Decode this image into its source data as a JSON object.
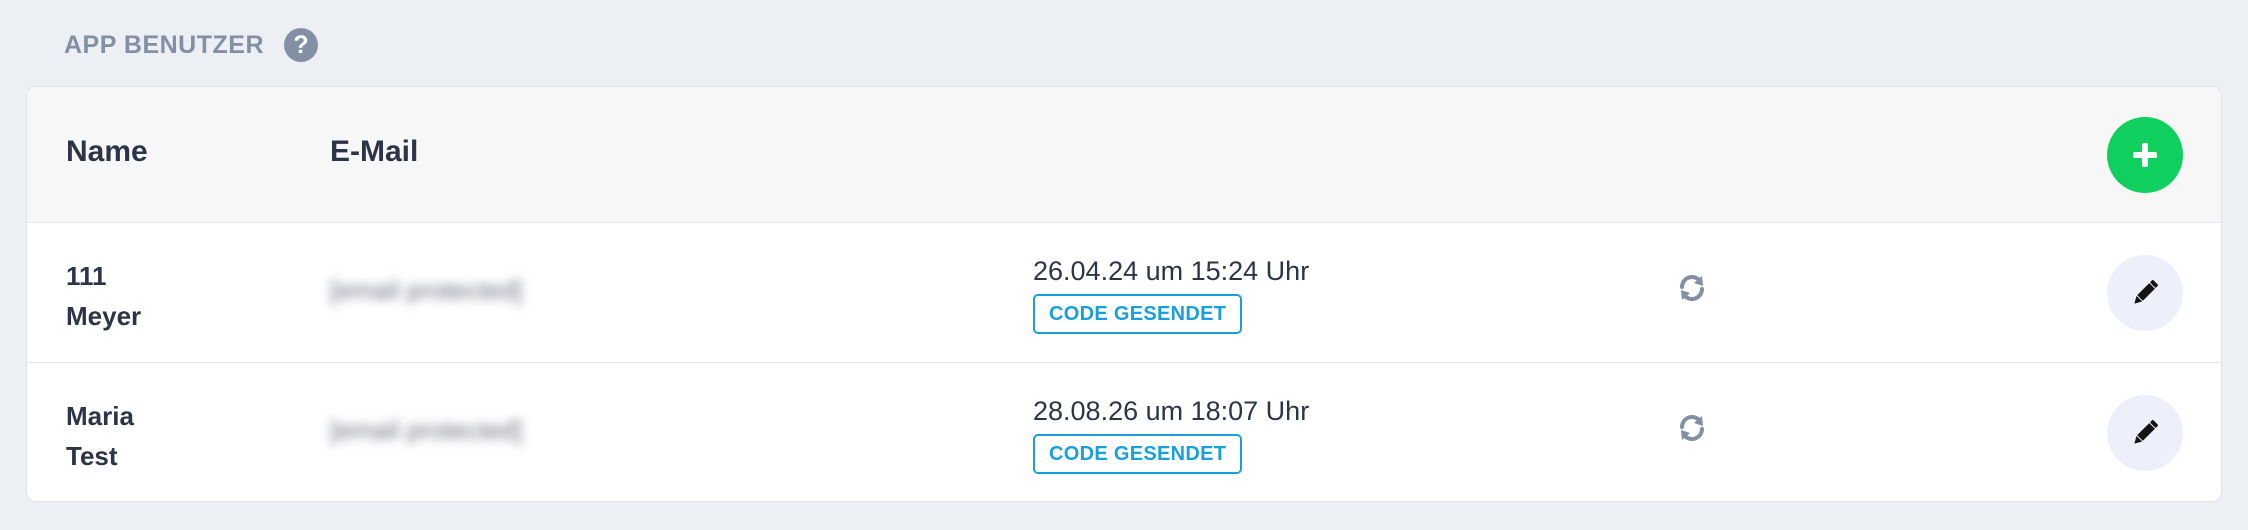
{
  "section": {
    "title": "APP BENUTZER",
    "help_icon": "question-circle-icon",
    "help_glyph": "?"
  },
  "table": {
    "columns": {
      "name": "Name",
      "email": "E-Mail"
    },
    "add_icon": "plus-icon",
    "rows": [
      {
        "first_name": "111",
        "last_name": "Meyer",
        "email": "[email protected]",
        "date": "26.04.24 um 15:24 Uhr",
        "status": "CODE GESENDET",
        "refresh_icon": "refresh-icon",
        "edit_icon": "pencil-icon"
      },
      {
        "first_name": "Maria",
        "last_name": "Test",
        "email": "[email protected]",
        "date": "28.08.26 um 18:07 Uhr",
        "status": "CODE GESENDET",
        "refresh_icon": "refresh-icon",
        "edit_icon": "pencil-icon"
      }
    ]
  },
  "colors": {
    "background": "#eceff4",
    "add_button": "#0fcf5e",
    "badge": "#1a9fde",
    "edit_button_bg": "#edeffa",
    "icon_gray": "#8390a3",
    "text_dark": "#2c3447"
  }
}
